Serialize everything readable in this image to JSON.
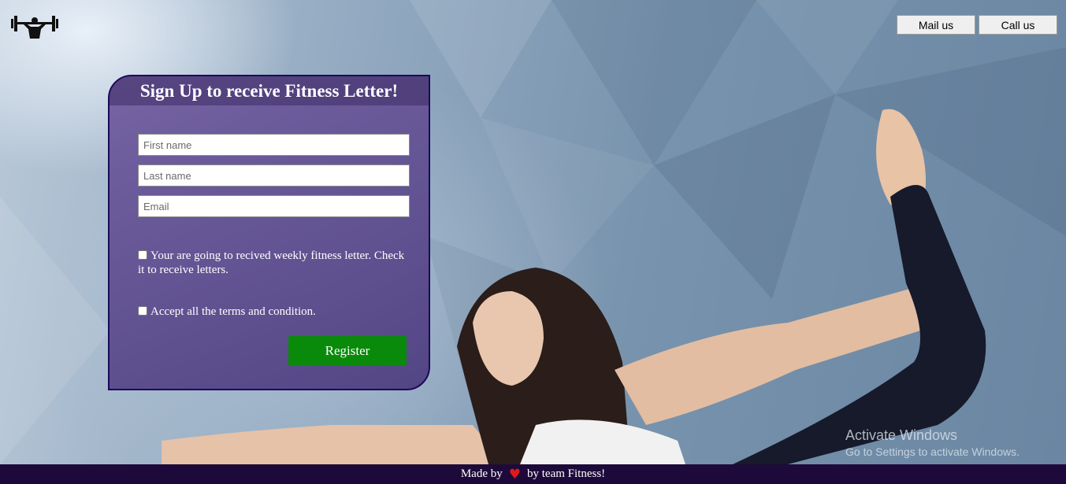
{
  "header": {
    "logo_icon": "dumbbell-lifter-icon",
    "mail_button": "Mail us",
    "call_button": "Call us"
  },
  "signup": {
    "title": "Sign Up to receive Fitness Letter!",
    "first_name_placeholder": "First name",
    "last_name_placeholder": "Last name",
    "email_placeholder": "Email",
    "newsletter_label": "Your are going to recived weekly fitness letter. Check it to receive letters.",
    "terms_label": "Accept all the terms and condition.",
    "register_button": "Register"
  },
  "watermark": {
    "line1": "Activate Windows",
    "line2": "Go to Settings to activate Windows."
  },
  "footer": {
    "made_by": "Made by",
    "heart_icon": "heart-icon",
    "by_team": "by team Fitness!"
  },
  "colors": {
    "card_border": "#1a0a5a",
    "register_bg": "#0a8a0a",
    "footer_bg": "#1e0a3a",
    "heart": "#e01a1a"
  }
}
